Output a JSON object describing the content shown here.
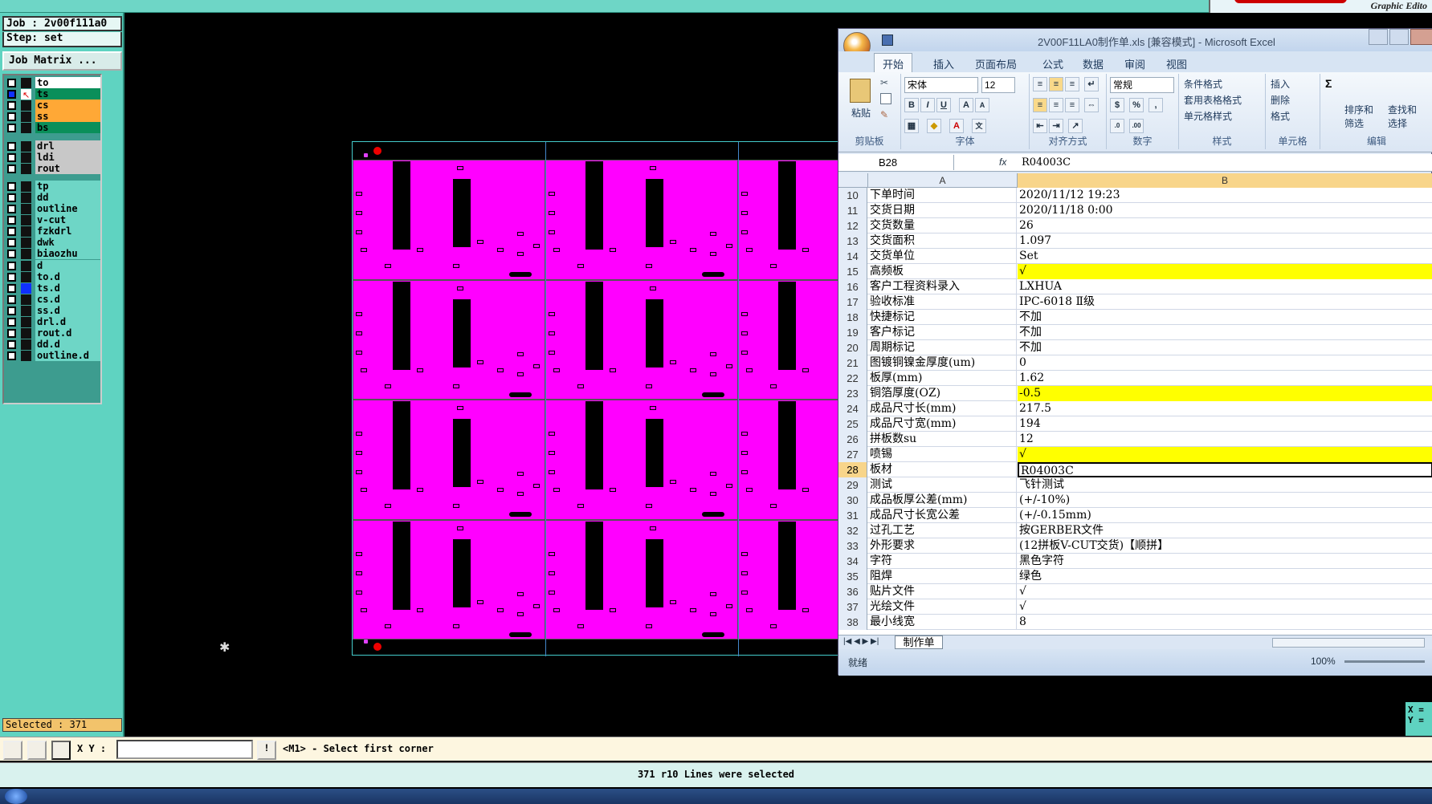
{
  "brand": {
    "graphic_editor": "Graphic Edito"
  },
  "left": {
    "job": "Job : 2v00f111a0",
    "step": "Step: set",
    "job_matrix": "Job Matrix ...",
    "selected": "Selected : 371"
  },
  "layers": [
    {
      "name": "to",
      "color": "#ffffff",
      "mark": ""
    },
    {
      "name": "ts",
      "color": "#0a8f5a",
      "mark": "active"
    },
    {
      "name": "cs",
      "color": "#ffa836",
      "mark": ""
    },
    {
      "name": "ss",
      "color": "#ffa836",
      "mark": ""
    },
    {
      "name": "bs",
      "color": "#0a8f5a",
      "mark": ""
    },
    {
      "name": "drl",
      "color": "#c8c8c8",
      "mark": ""
    },
    {
      "name": "ldi",
      "color": "#c8c8c8",
      "mark": ""
    },
    {
      "name": "rout",
      "color": "#c8c8c8",
      "mark": ""
    },
    {
      "name": "tp",
      "color": "#6ed6c6",
      "mark": ""
    },
    {
      "name": "dd",
      "color": "#6ed6c6",
      "mark": ""
    },
    {
      "name": "outline",
      "color": "#6ed6c6",
      "mark": ""
    },
    {
      "name": "v-cut",
      "color": "#6ed6c6",
      "mark": ""
    },
    {
      "name": "fzkdrl",
      "color": "#6ed6c6",
      "mark": ""
    },
    {
      "name": "dwk",
      "color": "#6ed6c6",
      "mark": ""
    },
    {
      "name": "biaozhu",
      "color": "#6ed6c6",
      "mark": ""
    },
    {
      "name": "d",
      "color": "#6ed6c6",
      "mark": ""
    },
    {
      "name": "to.d",
      "color": "#6ed6c6",
      "mark": ""
    },
    {
      "name": "ts.d",
      "color": "#6ed6c6",
      "mark": "blue"
    },
    {
      "name": "cs.d",
      "color": "#6ed6c6",
      "mark": ""
    },
    {
      "name": "ss.d",
      "color": "#6ed6c6",
      "mark": ""
    },
    {
      "name": "drl.d",
      "color": "#6ed6c6",
      "mark": ""
    },
    {
      "name": "rout.d",
      "color": "#6ed6c6",
      "mark": ""
    },
    {
      "name": "dd.d",
      "color": "#6ed6c6",
      "mark": ""
    },
    {
      "name": "outline.d",
      "color": "#6ed6c6",
      "mark": ""
    }
  ],
  "excel": {
    "title": "2V00F11LA0制作单.xls [兼容模式] - Microsoft Excel",
    "tabs": [
      "开始",
      "插入",
      "页面布局",
      "公式",
      "数据",
      "审阅",
      "视图"
    ],
    "ribbon": {
      "paste": "粘贴",
      "clipboard": "剪贴板",
      "font_name": "宋体",
      "font_size": "12",
      "font": "字体",
      "align": "对齐方式",
      "num_format": "常规",
      "number": "数字",
      "cond_format": "条件格式",
      "table_format": "套用表格格式",
      "cell_style": "单元格样式",
      "styles": "样式",
      "insert": "插入",
      "delete": "删除",
      "format": "格式",
      "cells": "单元格",
      "sort": "排序和筛选",
      "find": "查找和选择",
      "edit": "编辑"
    },
    "name_box": "B28",
    "fx": "fx",
    "formula": "R04003C",
    "col_a": "A",
    "col_b": "B",
    "rows": [
      {
        "n": "10",
        "a": "下单时间",
        "b": "2020/11/12 19:23",
        "hl": false
      },
      {
        "n": "11",
        "a": "交货日期",
        "b": "2020/11/18 0:00",
        "hl": false
      },
      {
        "n": "12",
        "a": "交货数量",
        "b": "26",
        "hl": false
      },
      {
        "n": "13",
        "a": "交货面积",
        "b": "1.097",
        "hl": false
      },
      {
        "n": "14",
        "a": "交货单位",
        "b": "Set",
        "hl": false
      },
      {
        "n": "15",
        "a": "高频板",
        "b": "√",
        "hl": true
      },
      {
        "n": "16",
        "a": "客户工程资料录入",
        "b": "LXHUA",
        "hl": false
      },
      {
        "n": "17",
        "a": "验收标准",
        "b": "IPC-6018 Ⅱ级",
        "hl": false
      },
      {
        "n": "18",
        "a": "快捷标记",
        "b": "不加",
        "hl": false
      },
      {
        "n": "19",
        "a": "客户标记",
        "b": "不加",
        "hl": false
      },
      {
        "n": "20",
        "a": "周期标记",
        "b": "不加",
        "hl": false
      },
      {
        "n": "21",
        "a": "图镀铜镍金厚度(um)",
        "b": "0",
        "hl": false
      },
      {
        "n": "22",
        "a": "板厚(mm)",
        "b": "1.62",
        "hl": false
      },
      {
        "n": "23",
        "a": "铜箔厚度(OZ)",
        "b": "-0.5",
        "hl": true
      },
      {
        "n": "24",
        "a": "成品尺寸长(mm)",
        "b": "217.5",
        "hl": false
      },
      {
        "n": "25",
        "a": "成品尺寸宽(mm)",
        "b": "194",
        "hl": false
      },
      {
        "n": "26",
        "a": "拼板数su",
        "b": "12",
        "hl": false
      },
      {
        "n": "27",
        "a": "喷锡",
        "b": "√",
        "hl": true
      },
      {
        "n": "28",
        "a": "板材",
        "b": "R04003C",
        "hl": false,
        "sel": true
      },
      {
        "n": "29",
        "a": "测试",
        "b": "飞针测试",
        "hl": false
      },
      {
        "n": "30",
        "a": "成品板厚公差(mm)",
        "b": "(+/-10%)",
        "hl": false
      },
      {
        "n": "31",
        "a": "成品尺寸长宽公差",
        "b": "(+/-0.15mm)",
        "hl": false
      },
      {
        "n": "32",
        "a": "过孔工艺",
        "b": "按GERBER文件",
        "hl": false
      },
      {
        "n": "33",
        "a": "外形要求",
        "b": "(12拼板V-CUT交货)【顺拼】",
        "hl": false
      },
      {
        "n": "34",
        "a": "字符",
        "b": "黑色字符",
        "hl": false
      },
      {
        "n": "35",
        "a": "阻焊",
        "b": "绿色",
        "hl": false
      },
      {
        "n": "36",
        "a": "贴片文件",
        "b": "√",
        "hl": false
      },
      {
        "n": "37",
        "a": "光绘文件",
        "b": "√",
        "hl": false
      },
      {
        "n": "38",
        "a": "最小线宽",
        "b": "8",
        "hl": false
      }
    ],
    "sheet_tab": "制作单",
    "status_ready": "就绪",
    "zoom": "100%"
  },
  "cmd": {
    "xy_label": "X Y :",
    "prompt": "<M1> - Select first corner"
  },
  "message": "371 r10 Lines were selected",
  "coords": {
    "x": "X =",
    "y": "Y ="
  }
}
